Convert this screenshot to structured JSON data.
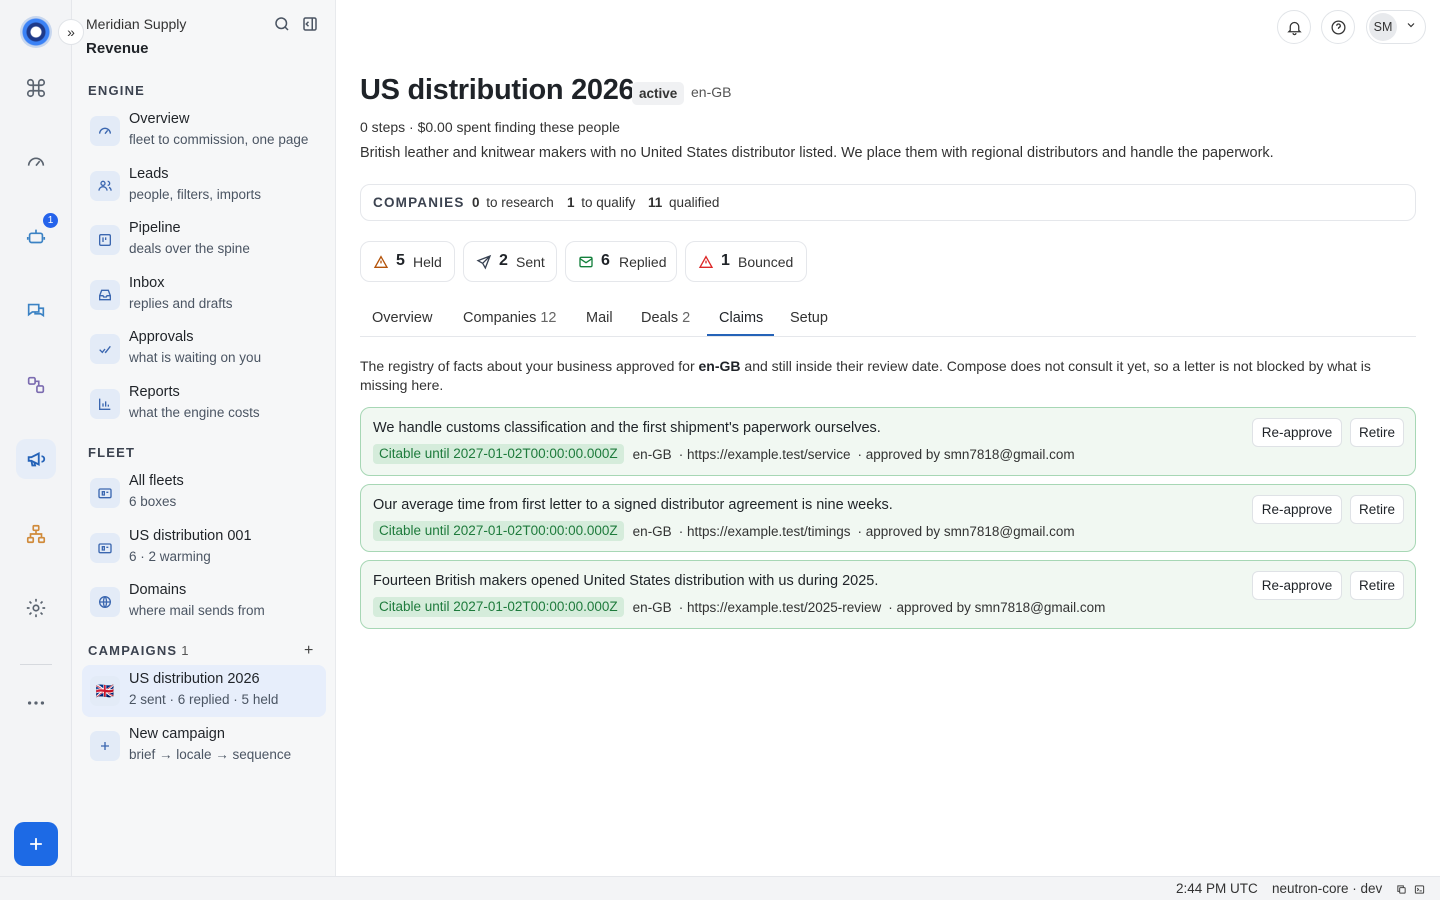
{
  "app": {
    "org_name": "Meridian Supply",
    "workspace": "Revenue"
  },
  "rail": {
    "items": [
      {
        "icon": "logo-icon"
      },
      {
        "icon": "command-icon"
      },
      {
        "icon": "gauge-icon"
      },
      {
        "icon": "robot-icon",
        "badge": "1"
      },
      {
        "icon": "chat-icon"
      },
      {
        "icon": "shapes-icon"
      },
      {
        "icon": "megaphone-icon",
        "active": true
      },
      {
        "icon": "org-chart-icon"
      },
      {
        "icon": "gear-icon"
      },
      {
        "icon": "more-icon"
      }
    ],
    "fab_icon": "plus-icon"
  },
  "sidebar": {
    "engine_heading": "ENGINE",
    "engine": [
      {
        "title": "Overview",
        "sub": "fleet to commission, one page",
        "icon": "gauge-icon"
      },
      {
        "title": "Leads",
        "sub": "people, filters, imports",
        "icon": "users-icon"
      },
      {
        "title": "Pipeline",
        "sub": "deals over the spine",
        "icon": "kanban-icon"
      },
      {
        "title": "Inbox",
        "sub": "replies and drafts",
        "icon": "inbox-icon"
      },
      {
        "title": "Approvals",
        "sub": "what is waiting on you",
        "icon": "check-icon"
      },
      {
        "title": "Reports",
        "sub": "what the engine costs",
        "icon": "bar-chart-icon"
      }
    ],
    "fleet_heading": "FLEET",
    "fleet": [
      {
        "title": "All fleets",
        "sub": "6 boxes",
        "icon": "box-icon"
      },
      {
        "title": "US distribution 001",
        "sub": "6 · 2 warming",
        "icon": "box-icon"
      },
      {
        "title": "Domains",
        "sub": "where mail sends from",
        "icon": "globe-icon"
      }
    ],
    "campaigns_heading": "CAMPAIGNS",
    "campaigns_count": "1",
    "campaigns": [
      {
        "title": "US distribution 2026",
        "sub": "2 sent · 6 replied · 5 held",
        "icon": "uk-flag-icon",
        "flag": "🇬🇧"
      },
      {
        "title": "New campaign",
        "sub": "brief → locale → sequence",
        "icon": "plus-icon"
      }
    ]
  },
  "header": {
    "user_initials": "SM"
  },
  "campaign": {
    "title": "US distribution 2026",
    "status": "active",
    "locale": "en-GB",
    "meta": "0 steps · $0.00 spent finding these people",
    "description": "British leather and knitwear makers with no United States distributor listed. We place them with regional distributors and handle the paperwork."
  },
  "companies": {
    "label": "COMPANIES",
    "stats": [
      {
        "n": "0",
        "label": "to research"
      },
      {
        "n": "1",
        "label": "to qualify"
      },
      {
        "n": "11",
        "label": "qualified"
      }
    ]
  },
  "mail_stats": [
    {
      "n": "5",
      "label": "Held",
      "icon": "warning-icon",
      "color": "#b45309"
    },
    {
      "n": "2",
      "label": "Sent",
      "icon": "send-icon",
      "color": "#374151"
    },
    {
      "n": "6",
      "label": "Replied",
      "icon": "mail-icon",
      "color": "#15803d"
    },
    {
      "n": "1",
      "label": "Bounced",
      "icon": "alert-icon",
      "color": "#dc2626"
    }
  ],
  "tabs": [
    {
      "label": "Overview",
      "count": ""
    },
    {
      "label": "Companies",
      "count": "12"
    },
    {
      "label": "Mail",
      "count": ""
    },
    {
      "label": "Deals",
      "count": "2"
    },
    {
      "label": "Claims",
      "count": "",
      "active": true
    },
    {
      "label": "Setup",
      "count": ""
    }
  ],
  "claims_intro": {
    "before": "The registry of facts about your business approved for ",
    "locale": "en-GB",
    "after": " and still inside their review date. Compose does not consult it yet, so a letter is not blocked by what is missing here."
  },
  "claims": [
    {
      "text": "We handle customs classification and the first shipment's paperwork ourselves.",
      "citable": "Citable until 2027-01-02T00:00:00.000Z",
      "locale": "en-GB",
      "source": "· https://example.test/service",
      "approved": "· approved by smn7818@gmail.com",
      "reapprove": "Re-approve",
      "retire": "Retire"
    },
    {
      "text": "Our average time from first letter to a signed distributor agreement is nine weeks.",
      "citable": "Citable until 2027-01-02T00:00:00.000Z",
      "locale": "en-GB",
      "source": "· https://example.test/timings",
      "approved": "· approved by smn7818@gmail.com",
      "reapprove": "Re-approve",
      "retire": "Retire"
    },
    {
      "text": "Fourteen British makers opened United States distribution with us during 2025.",
      "citable": "Citable until 2027-01-02T00:00:00.000Z",
      "locale": "en-GB",
      "source": "· https://example.test/2025-review",
      "approved": "· approved by smn7818@gmail.com",
      "reapprove": "Re-approve",
      "retire": "Retire"
    }
  ],
  "footer": {
    "time": "2:44 PM UTC",
    "env": "neutron-core · dev"
  },
  "colors": {
    "accent": "#2563b8",
    "fab": "#1d6ae5",
    "claim_border": "#a7d7b5",
    "claim_bg": "#f1f8f2",
    "citable_text": "#1e7b3c"
  }
}
